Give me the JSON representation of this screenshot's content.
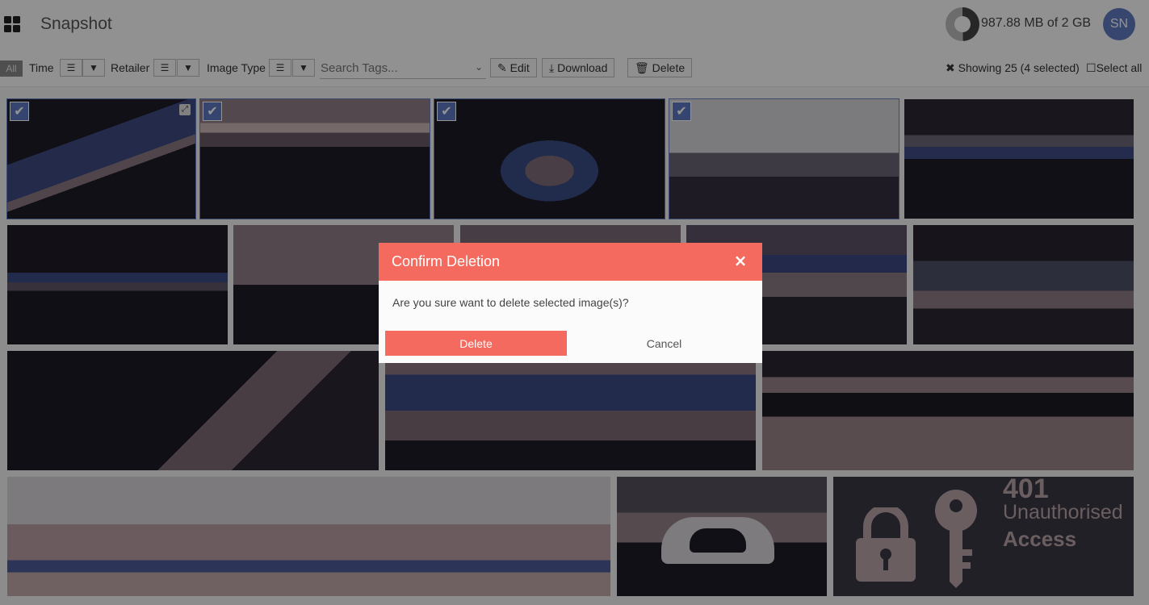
{
  "header": {
    "title": "Snapshot",
    "storage_text": "987.88 MB of 2 GB",
    "storage_fraction": 0.494,
    "avatar_initials": "SN"
  },
  "toolbar": {
    "all_label": "All",
    "filters": [
      {
        "label": "Time"
      },
      {
        "label": "Retailer"
      },
      {
        "label": "Image Type"
      }
    ],
    "search_placeholder": "Search Tags...",
    "edit_label": "Edit",
    "download_label": "Download",
    "delete_label": "Delete",
    "showing_text": "Showing 25 (4 selected)",
    "select_all_label": "Select all"
  },
  "gallery": {
    "error_tile": {
      "code": "401",
      "line1": "Unauthorised",
      "line2": "Access"
    }
  },
  "modal": {
    "title": "Confirm Deletion",
    "close_glyph": "×",
    "message": "Are you sure want to delete selected image(s)?",
    "delete_label": "Delete",
    "cancel_label": "Cancel"
  },
  "colors": {
    "accent": "#f56a5e",
    "selection": "#5c78bf",
    "avatar": "#5d79bd"
  }
}
